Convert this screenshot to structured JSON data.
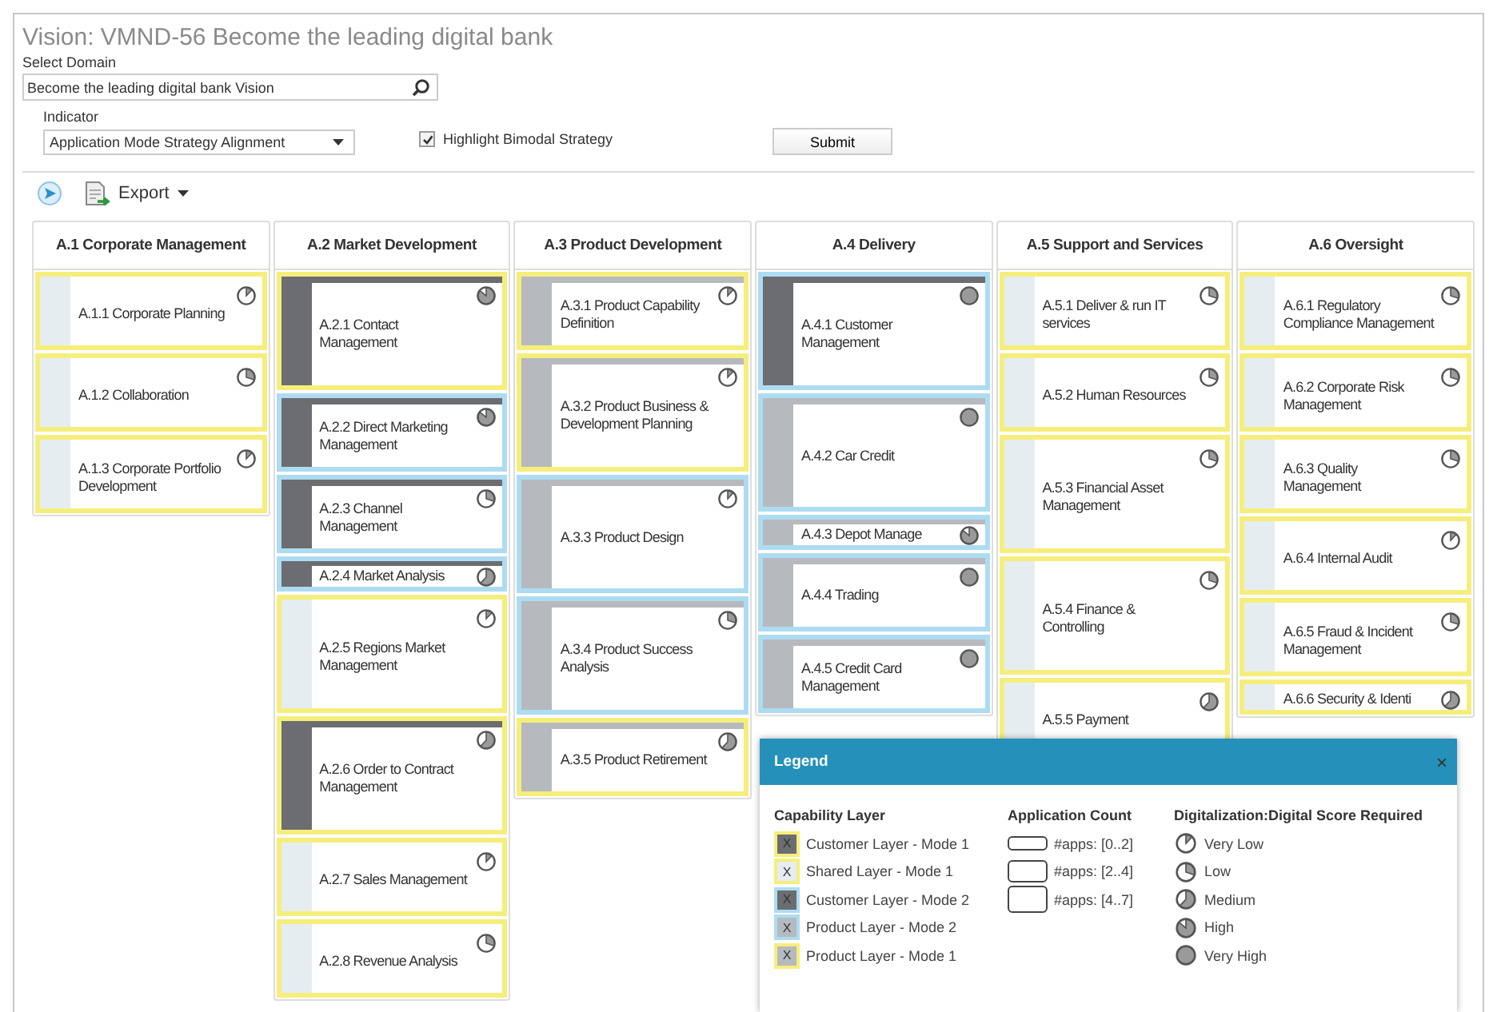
{
  "title": "Vision: VMND-56 Become the leading digital bank",
  "domain": {
    "label": "Select Domain",
    "value": "Become the leading digital bank Vision"
  },
  "indicator": {
    "label": "Indicator",
    "value": "Application Mode Strategy Alignment"
  },
  "highlight": {
    "label": "Highlight Bimodal Strategy",
    "checked": true
  },
  "submit": "Submit",
  "toolbar": {
    "export": "Export"
  },
  "columns": [
    {
      "title": "A.1 Corporate Management",
      "cards": [
        {
          "label": "A.1.1 Corporate Planning",
          "kind": "shared",
          "mode2": false,
          "compact": false,
          "tall": false,
          "icon": {
            "kind": "very_low"
          }
        },
        {
          "label": "A.1.2 Collaboration",
          "kind": "shared",
          "mode2": false,
          "compact": false,
          "tall": false,
          "icon": {
            "kind": "low"
          }
        },
        {
          "label": "A.1.3 Corporate Portfolio Development",
          "kind": "shared",
          "mode2": false,
          "compact": false,
          "tall": false,
          "icon": {
            "kind": "very_low"
          }
        }
      ]
    },
    {
      "title": "A.2 Market Development",
      "cards": [
        {
          "label": "A.2.1 Contact Management",
          "kind": "customer",
          "mode2": false,
          "compact": false,
          "tall": true,
          "icon": {
            "kind": "high"
          }
        },
        {
          "label": "A.2.2 Direct Marketing Management",
          "kind": "customer",
          "mode2": true,
          "compact": false,
          "tall": false,
          "icon": {
            "kind": "high"
          }
        },
        {
          "label": "A.2.3 Channel Management",
          "kind": "customer",
          "mode2": true,
          "compact": false,
          "tall": false,
          "icon": {
            "kind": "low"
          }
        },
        {
          "label": "A.2.4 Market Analysis",
          "kind": "customer",
          "mode2": true,
          "compact": true,
          "tall": false,
          "icon": {
            "kind": "medium"
          }
        },
        {
          "label": "A.2.5 Regions Market Management",
          "kind": "shared",
          "mode2": false,
          "compact": false,
          "tall": true,
          "icon": {
            "kind": "very_low"
          }
        },
        {
          "label": "A.2.6 Order to Contract Management",
          "kind": "customer",
          "mode2": false,
          "compact": false,
          "tall": true,
          "icon": {
            "kind": "medium"
          }
        },
        {
          "label": "A.2.7 Sales Management",
          "kind": "shared",
          "mode2": false,
          "compact": false,
          "tall": false,
          "icon": {
            "kind": "very_low"
          }
        },
        {
          "label": "A.2.8 Revenue Analysis",
          "kind": "shared",
          "mode2": false,
          "compact": false,
          "tall": false,
          "icon": {
            "kind": "low"
          }
        }
      ]
    },
    {
      "title": "A.3 Product Development",
      "cards": [
        {
          "label": "A.3.1 Product Capability Definition",
          "kind": "product",
          "mode2": false,
          "compact": false,
          "tall": false,
          "icon": {
            "kind": "very_low"
          }
        },
        {
          "label": "A.3.2 Product Business & Development Planning",
          "kind": "product",
          "mode2": false,
          "compact": false,
          "tall": true,
          "icon": {
            "kind": "very_low"
          }
        },
        {
          "label": "A.3.3 Product Design",
          "kind": "product",
          "mode2": true,
          "compact": false,
          "tall": true,
          "icon": {
            "kind": "very_low"
          }
        },
        {
          "label": "A.3.4 Product Success Analysis",
          "kind": "product",
          "mode2": true,
          "compact": false,
          "tall": true,
          "icon": {
            "kind": "low"
          }
        },
        {
          "label": "A.3.5 Product Retirement",
          "kind": "product",
          "mode2": false,
          "compact": false,
          "tall": false,
          "icon": {
            "kind": "medium"
          }
        }
      ]
    },
    {
      "title": "A.4 Delivery",
      "cards": [
        {
          "label": "A.4.1 Customer Management",
          "kind": "customer",
          "mode2": true,
          "compact": false,
          "tall": true,
          "icon": {
            "kind": "very_high"
          }
        },
        {
          "label": "A.4.2 Car Credit",
          "kind": "product",
          "mode2": true,
          "compact": false,
          "tall": true,
          "icon": {
            "kind": "very_high"
          }
        },
        {
          "label": "A.4.3 Depot Manage",
          "kind": "product",
          "mode2": true,
          "compact": true,
          "tall": false,
          "icon": {
            "kind": "high"
          }
        },
        {
          "label": "A.4.4 Trading",
          "kind": "product",
          "mode2": true,
          "compact": false,
          "tall": false,
          "icon": {
            "kind": "very_high"
          }
        },
        {
          "label": "A.4.5 Credit Card Management",
          "kind": "product",
          "mode2": true,
          "compact": false,
          "tall": false,
          "icon": {
            "kind": "very_high"
          }
        }
      ]
    },
    {
      "title": "A.5 Support and Services",
      "cards": [
        {
          "label": "A.5.1 Deliver & run IT services",
          "kind": "shared",
          "mode2": false,
          "compact": false,
          "tall": false,
          "icon": {
            "kind": "low"
          }
        },
        {
          "label": "A.5.2 Human Resources",
          "kind": "shared",
          "mode2": false,
          "compact": false,
          "tall": false,
          "icon": {
            "kind": "low"
          }
        },
        {
          "label": "A.5.3 Financial Asset Management",
          "kind": "shared",
          "mode2": false,
          "compact": false,
          "tall": true,
          "icon": {
            "kind": "low"
          }
        },
        {
          "label": "A.5.4 Finance & Controlling",
          "kind": "shared",
          "mode2": false,
          "compact": false,
          "tall": true,
          "icon": {
            "kind": "low"
          }
        },
        {
          "label": "A.5.5 Payment",
          "kind": "shared",
          "mode2": false,
          "compact": false,
          "tall": false,
          "icon": {
            "kind": "medium"
          }
        }
      ]
    },
    {
      "title": "A.6 Oversight",
      "cards": [
        {
          "label": "A.6.1 Regulatory Compliance Management",
          "kind": "shared",
          "mode2": false,
          "compact": false,
          "tall": false,
          "icon": {
            "kind": "low"
          }
        },
        {
          "label": "A.6.2 Corporate Risk Management",
          "kind": "shared",
          "mode2": false,
          "compact": false,
          "tall": false,
          "icon": {
            "kind": "low"
          }
        },
        {
          "label": "A.6.3 Quality Management",
          "kind": "shared",
          "mode2": false,
          "compact": false,
          "tall": false,
          "icon": {
            "kind": "low"
          }
        },
        {
          "label": "A.6.4 Internal Audit",
          "kind": "shared",
          "mode2": false,
          "compact": false,
          "tall": false,
          "icon": {
            "kind": "very_low"
          }
        },
        {
          "label": "A.6.5 Fraud & Incident Management",
          "kind": "shared",
          "mode2": false,
          "compact": false,
          "tall": false,
          "icon": {
            "kind": "low"
          }
        },
        {
          "label": "A.6.6 Security & Identi",
          "kind": "shared",
          "mode2": false,
          "compact": true,
          "tall": false,
          "icon": {
            "kind": "medium"
          }
        }
      ]
    }
  ],
  "legend": {
    "title": "Legend",
    "close": "×",
    "layers": {
      "title": "Capability Layer",
      "items": [
        {
          "mark": "X",
          "label": "Customer Layer - Mode 1",
          "kind": "customer",
          "mode2": false
        },
        {
          "mark": "X",
          "label": "Shared Layer - Mode 1",
          "kind": "shared",
          "mode2": false
        },
        {
          "mark": "X",
          "label": "Customer Layer - Mode 2",
          "kind": "customer",
          "mode2": true
        },
        {
          "mark": "X",
          "label": "Product Layer - Mode 2",
          "kind": "product",
          "mode2": true
        },
        {
          "mark": "X",
          "label": "Product Layer - Mode 1",
          "kind": "product",
          "mode2": false
        }
      ]
    },
    "counts": {
      "title": "Application Count",
      "items": [
        {
          "label": "#apps: [0..2]",
          "compact": true,
          "tall": false
        },
        {
          "label": "#apps: [2..4]",
          "compact": false,
          "tall": false
        },
        {
          "label": "#apps: [4..7]",
          "compact": false,
          "tall": true
        }
      ]
    },
    "scores": {
      "title": "Digitalization:Digital Score Required",
      "items": [
        {
          "label": "Very Low",
          "icon": {
            "kind": "very_low"
          }
        },
        {
          "label": "Low",
          "icon": {
            "kind": "low"
          }
        },
        {
          "label": "Medium",
          "icon": {
            "kind": "medium"
          }
        },
        {
          "label": "High",
          "icon": {
            "kind": "high"
          }
        },
        {
          "label": "Very High",
          "icon": {
            "kind": "very_high"
          }
        }
      ]
    }
  }
}
